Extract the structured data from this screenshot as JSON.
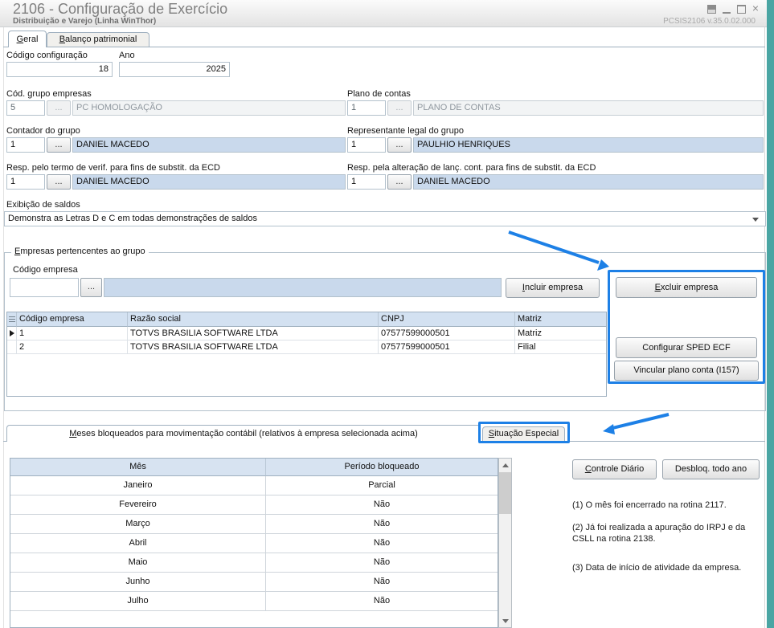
{
  "window": {
    "title": "2106 - Configuração de Exercício",
    "subtitle": "Distribuição e Varejo (Linha WinThor)",
    "version": "PCSIS2106 v.35.0.02.000"
  },
  "icons": {
    "close": "×"
  },
  "annotations": {
    "highlight_color": "#1d80e6"
  },
  "tabs": {
    "geral": "Geral",
    "balanco": "Balanço patrimonial"
  },
  "form": {
    "ellipsis": "...",
    "codigo_configuracao_label": "Código configuração",
    "codigo_configuracao_value": "18",
    "ano_label": "Ano",
    "ano_value": "2025",
    "grupo_label": "Cód. grupo empresas",
    "grupo_code": "5",
    "grupo_name": "PC HOMOLOGAÇÃO",
    "plano_label": "Plano de contas",
    "plano_code": "1",
    "plano_name": "PLANO DE CONTAS",
    "contador_label": "Contador do grupo",
    "contador_code": "1",
    "contador_name": "DANIEL MACEDO",
    "representante_label": "Representante legal do grupo",
    "representante_code": "1",
    "representante_name": "PAULHIO HENRIQUES",
    "resp_termo_label": "Resp. pelo termo de verif. para fins de substit. da ECD",
    "resp_termo_code": "1",
    "resp_termo_name": "DANIEL MACEDO",
    "resp_alt_label": "Resp. pela alteração de lanç. cont. para fins de substit. da ECD",
    "resp_alt_code": "1",
    "resp_alt_name": "DANIEL MACEDO",
    "exibicao_label": "Exibição de saldos",
    "exibicao_value": "Demonstra as Letras D e C em todas demonstrações de saldos"
  },
  "empresas": {
    "group_title": "Empresas pertencentes ao grupo",
    "codigo_label": "Código empresa",
    "codigo_value": "",
    "nome_value": "",
    "incluir_button": "Incluir empresa",
    "excluir_button": "Excluir empresa",
    "sped_button": "Configurar SPED ECF",
    "vincular_button": "Vincular plano conta (I157)",
    "headers": {
      "codigo": "Código empresa",
      "razao": "Razão social",
      "cnpj": "CNPJ",
      "matriz": "Matriz"
    },
    "rows": [
      {
        "codigo": "1",
        "razao": "TOTVS BRASILIA SOFTWARE LTDA",
        "cnpj": "07577599000501",
        "matriz": "Matriz"
      },
      {
        "codigo": "2",
        "razao": "TOTVS BRASILIA SOFTWARE LTDA",
        "cnpj": "07577599000501",
        "matriz": "Filial"
      }
    ]
  },
  "meses": {
    "tab_meses": "Meses bloqueados para movimentação contábil (relativos à empresa selecionada acima)",
    "tab_situacao": "Situação Especial",
    "headers": {
      "mes": "Mês",
      "periodo": "Período bloqueado"
    },
    "rows": [
      {
        "mes": "Janeiro",
        "periodo": "Parcial"
      },
      {
        "mes": "Fevereiro",
        "periodo": "Não"
      },
      {
        "mes": "Março",
        "periodo": "Não"
      },
      {
        "mes": "Abril",
        "periodo": "Não"
      },
      {
        "mes": "Maio",
        "periodo": "Não"
      },
      {
        "mes": "Junho",
        "periodo": "Não"
      },
      {
        "mes": "Julho",
        "periodo": "Não"
      }
    ],
    "controle_button": "Controle Diário",
    "desbloq_button": "Desbloq. todo ano",
    "notes": [
      "(1) O mês foi encerrado na rotina 2117.",
      "(2) Já foi realizada a apuração do IRPJ e da CSLL na rotina 2138.",
      "(3) Data de início de atividade da empresa."
    ]
  }
}
